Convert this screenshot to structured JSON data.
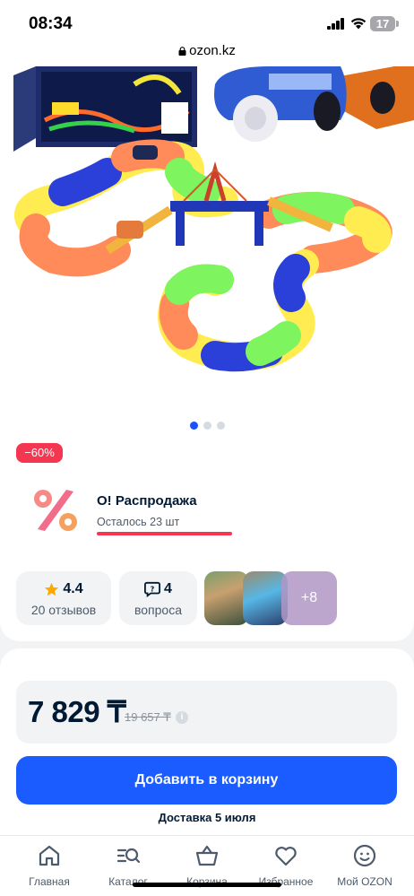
{
  "status_bar": {
    "time": "08:34",
    "battery": "17"
  },
  "browser": {
    "url": "ozon.kz"
  },
  "carousel": {
    "total_slides": 3,
    "active_slide": 1
  },
  "promo": {
    "discount_badge": "−60%",
    "title": "О! Распродажа",
    "remaining": "Осталось 23 шт"
  },
  "stats": {
    "rating_value": "4.4",
    "rating_label": "20 отзывов",
    "questions_value": "4",
    "questions_label": "вопроса"
  },
  "gallery": {
    "more_label": "+8"
  },
  "price": {
    "current": "7 829 ₸",
    "old": "19 657 ₸"
  },
  "actions": {
    "add_to_cart": "Добавить в корзину",
    "delivery": "Доставка 5 июля"
  },
  "bottom_nav": {
    "items": [
      {
        "label": "Главная",
        "icon": "home-icon"
      },
      {
        "label": "Каталог",
        "icon": "catalog-search-icon"
      },
      {
        "label": "Корзина",
        "icon": "basket-icon"
      },
      {
        "label": "Избранное",
        "icon": "heart-icon"
      },
      {
        "label": "Мой OZON",
        "icon": "smiley-icon"
      }
    ]
  },
  "colors": {
    "accent_blue": "#1a5cff",
    "discount_red": "#f53650",
    "text_dark": "#001a34"
  }
}
